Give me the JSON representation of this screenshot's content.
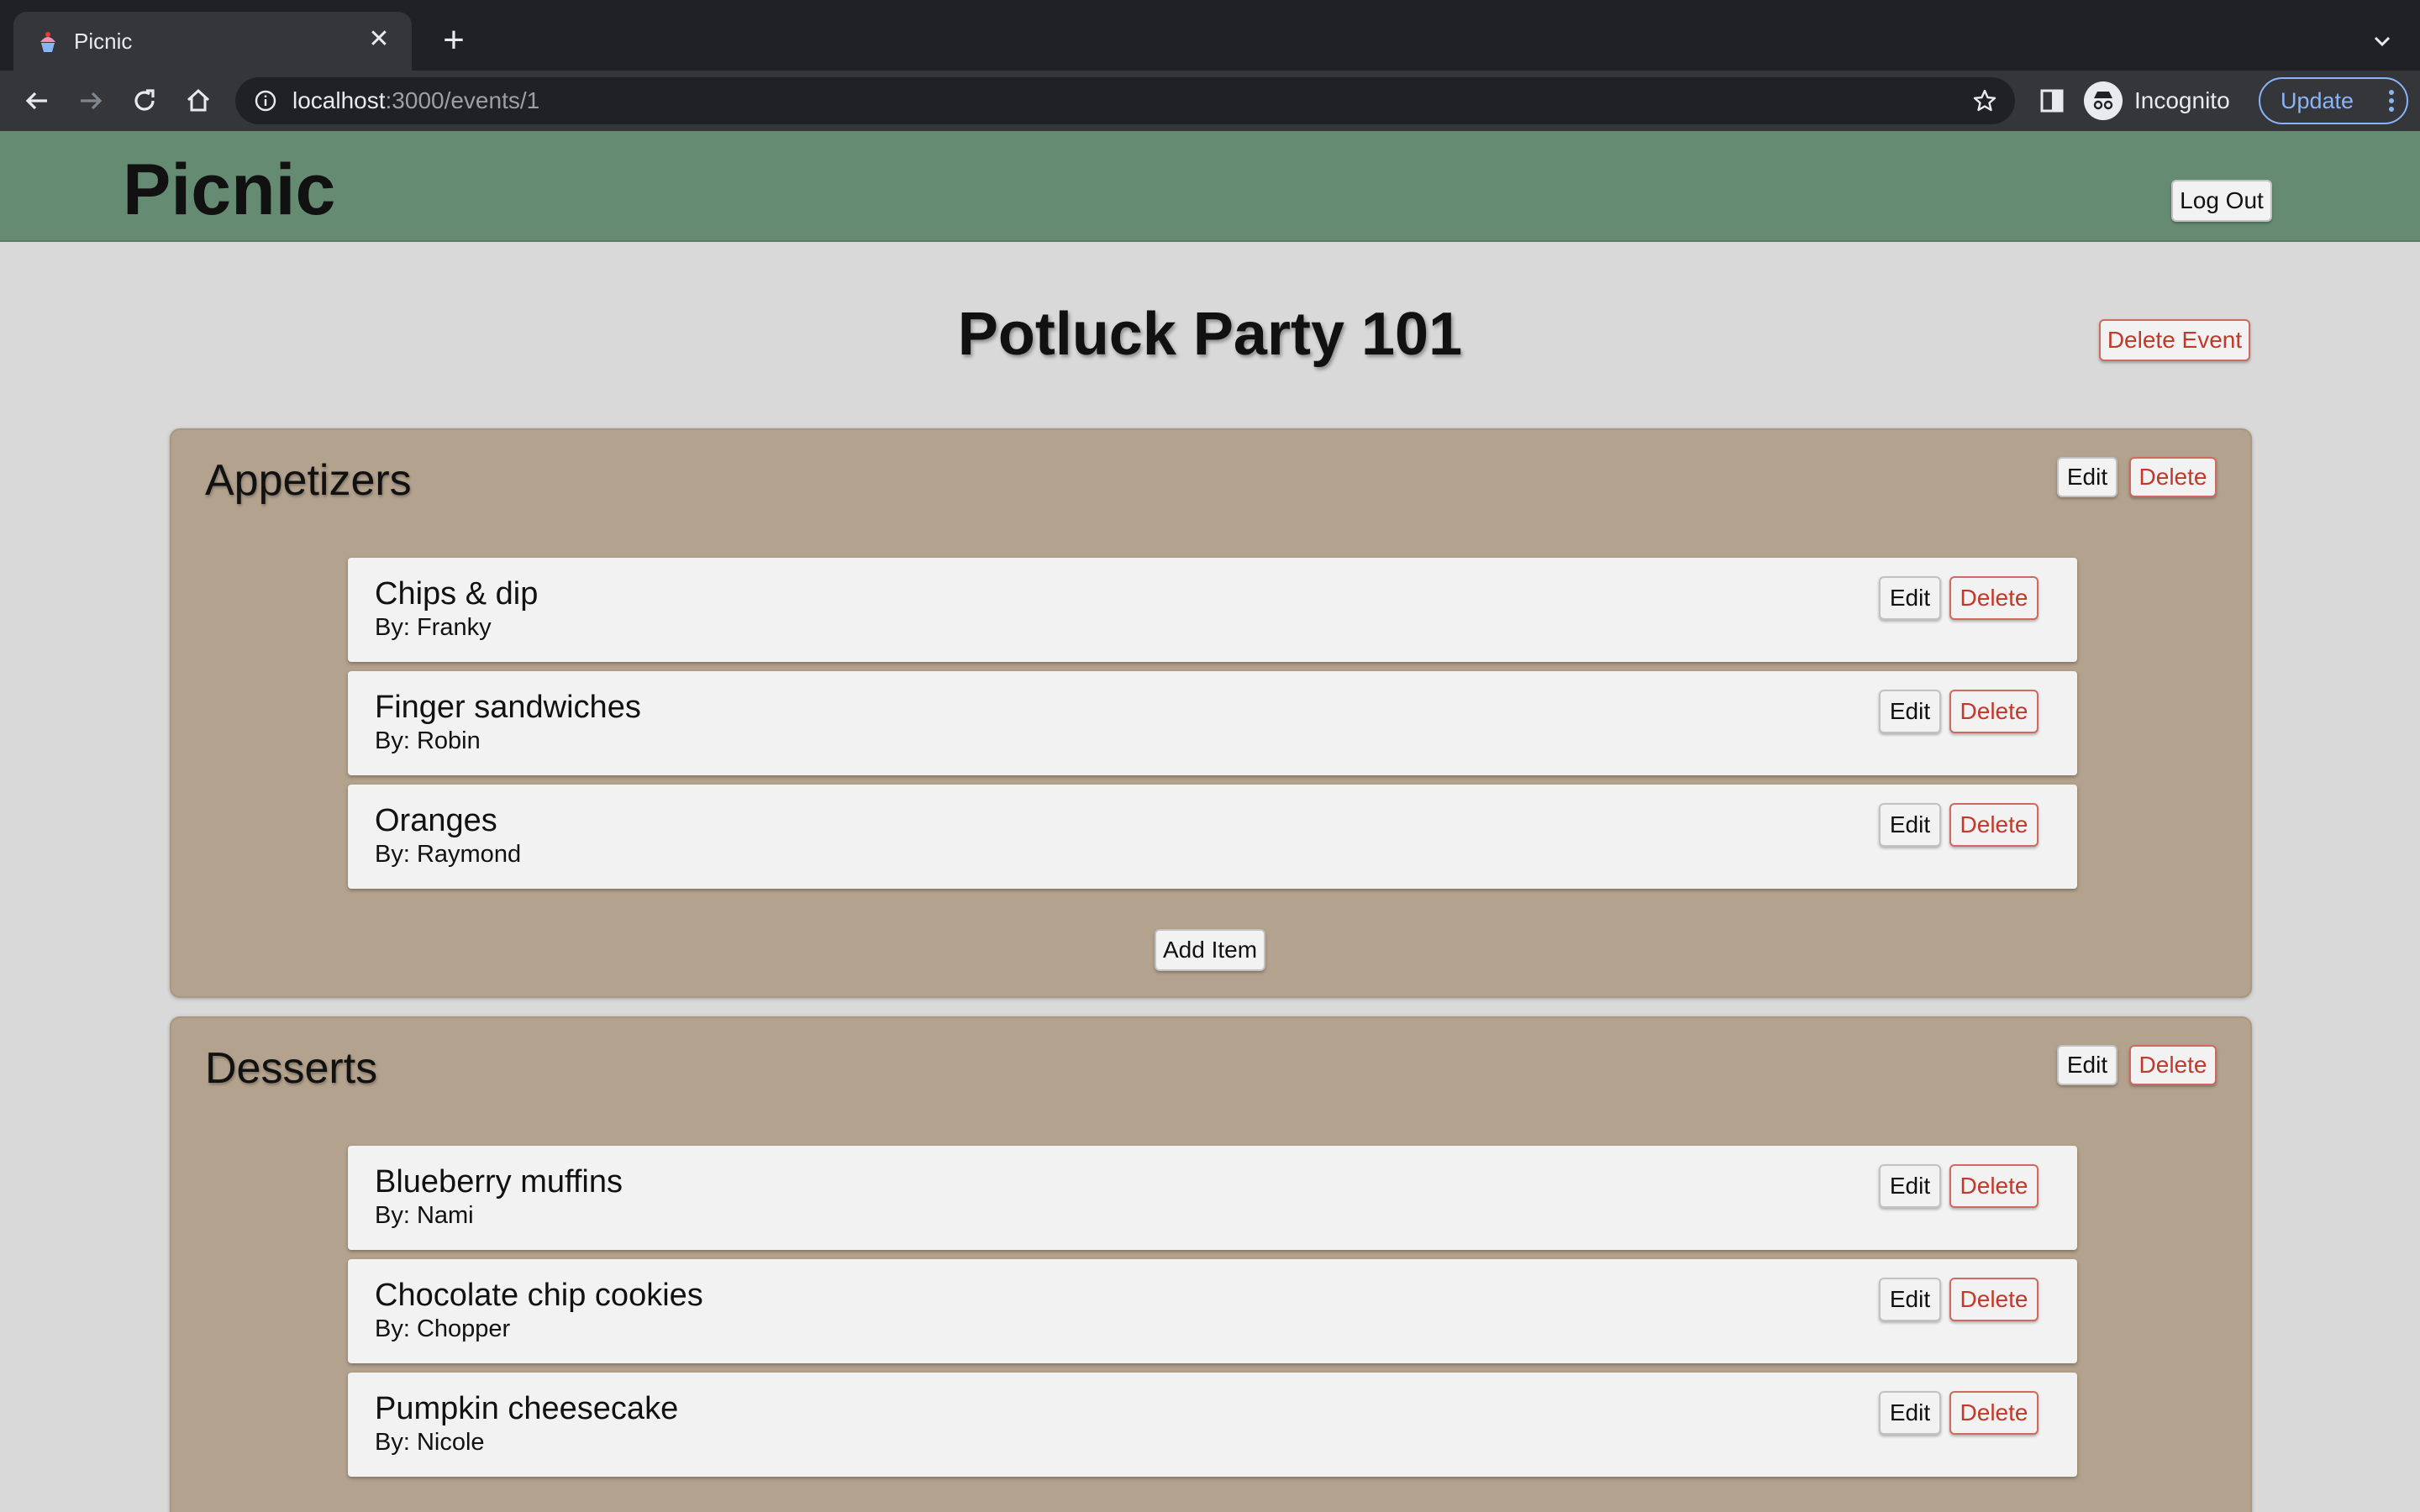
{
  "browser": {
    "tab_title": "Picnic",
    "url_host": "localhost",
    "url_rest": ":3000/events/1",
    "profile_label": "Incognito",
    "update_label": "Update",
    "icons": [
      "back-icon",
      "forward-icon",
      "reload-icon",
      "home-icon",
      "info-icon",
      "star-icon",
      "side-panel-icon",
      "incognito-icon",
      "more-icon",
      "close-icon",
      "plus-icon",
      "chevron-down-icon"
    ]
  },
  "header": {
    "brand": "Picnic",
    "logout_label": "Log Out",
    "color": "#658c72"
  },
  "event": {
    "title": "Potluck Party 101",
    "delete_label": "Delete Event"
  },
  "labels": {
    "edit": "Edit",
    "delete": "Delete",
    "add_item": "Add Item"
  },
  "colors": {
    "category_bg": "#b3a28d",
    "danger": "#c0392b",
    "page_bg": "#d9d9d9"
  },
  "categories": [
    {
      "name": "Appetizers",
      "items": [
        {
          "name": "Chips & dip",
          "by": "By: Franky"
        },
        {
          "name": "Finger sandwiches",
          "by": "By: Robin"
        },
        {
          "name": "Oranges",
          "by": "By: Raymond"
        }
      ]
    },
    {
      "name": "Desserts",
      "items": [
        {
          "name": "Blueberry muffins",
          "by": "By: Nami"
        },
        {
          "name": "Chocolate chip cookies",
          "by": "By: Chopper"
        },
        {
          "name": "Pumpkin cheesecake",
          "by": "By: Nicole"
        }
      ]
    }
  ]
}
